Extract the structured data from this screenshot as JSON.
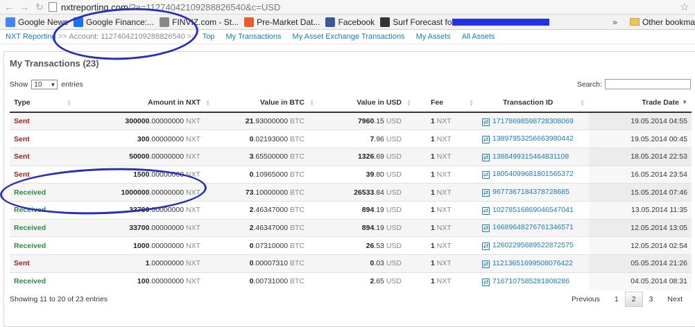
{
  "browser": {
    "url_host": "nxtreporting.com",
    "url_rest": "/?a=11274042109288826540&c=USD",
    "bookmarks": [
      {
        "label": "Google News",
        "icon": "google-news-icon",
        "color": "#4285f4"
      },
      {
        "label": "Google Finance:...",
        "icon": "google-finance-icon",
        "color": "#1a73e8"
      },
      {
        "label": "FINVIZ.com - St...",
        "icon": "finviz-icon",
        "color": "#888888"
      },
      {
        "label": "Pre-Market Dat...",
        "icon": "nbc-peacock-icon",
        "color": "#e85d2a"
      },
      {
        "label": "Facebook",
        "icon": "facebook-icon",
        "color": "#3b5998"
      },
      {
        "label": "Surf Forecast fo...",
        "icon": "surf-forecast-icon",
        "color": "#333333"
      }
    ],
    "more": "»",
    "other_bookmarks": "Other bookma"
  },
  "site_nav": {
    "brand": "NXT Reporting",
    "sep": ">>",
    "account": "Account: 11274042109288826540",
    "sep2": ">>",
    "links": [
      "Top",
      "My Transactions",
      "My Asset Exchange Transactions",
      "My Assets",
      "All Assets"
    ]
  },
  "panel": {
    "title": "My Transactions (23)",
    "show_label": "Show",
    "show_value": "10",
    "entries_label": "entries",
    "search_label": "Search:"
  },
  "table": {
    "columns": [
      "Type",
      "Amount in NXT",
      "Value in BTC",
      "Value in USD",
      "Fee",
      "Transaction ID",
      "Trade Date"
    ],
    "rows": [
      {
        "type": "Sent",
        "amount_int": "300000",
        "amount_dec": ".00000000",
        "amount_unit": "NXT",
        "btc_int": "21",
        "btc_dec": ".93000000",
        "btc_unit": "BTC",
        "usd_int": "7960",
        "usd_dec": ".15",
        "usd_unit": "USD",
        "fee_int": "1",
        "fee_unit": "NXT",
        "tx_id": "17178698598728308069",
        "date": "19.05.2014 04:55"
      },
      {
        "type": "Sent",
        "amount_int": "300",
        "amount_dec": ".00000000",
        "amount_unit": "NXT",
        "btc_int": "0",
        "btc_dec": ".02193000",
        "btc_unit": "BTC",
        "usd_int": "7",
        "usd_dec": ".96",
        "usd_unit": "USD",
        "fee_int": "1",
        "fee_unit": "NXT",
        "tx_id": "13897953256663980442",
        "date": "19.05.2014 00:45"
      },
      {
        "type": "Sent",
        "amount_int": "50000",
        "amount_dec": ".00000000",
        "amount_unit": "NXT",
        "btc_int": "3",
        "btc_dec": ".65500000",
        "btc_unit": "BTC",
        "usd_int": "1326",
        "usd_dec": ".69",
        "usd_unit": "USD",
        "fee_int": "1",
        "fee_unit": "NXT",
        "tx_id": "1388499315464831108",
        "date": "18.05.2014 22:53"
      },
      {
        "type": "Sent",
        "amount_int": "1500",
        "amount_dec": ".00000000",
        "amount_unit": "NXT",
        "btc_int": "0",
        "btc_dec": ".10965000",
        "btc_unit": "BTC",
        "usd_int": "39",
        "usd_dec": ".80",
        "usd_unit": "USD",
        "fee_int": "1",
        "fee_unit": "NXT",
        "tx_id": "18054099681801565372",
        "date": "16.05.2014 23:54"
      },
      {
        "type": "Received",
        "amount_int": "1000000",
        "amount_dec": ".00000000",
        "amount_unit": "NXT",
        "btc_int": "73",
        "btc_dec": ".10000000",
        "btc_unit": "BTC",
        "usd_int": "26533",
        "usd_dec": ".84",
        "usd_unit": "USD",
        "fee_int": "1",
        "fee_unit": "NXT",
        "tx_id": "9677367184378728685",
        "date": "15.05.2014 07:46"
      },
      {
        "type": "Received",
        "amount_int": "33700",
        "amount_dec": ".00000000",
        "amount_unit": "NXT",
        "btc_int": "2",
        "btc_dec": ".46347000",
        "btc_unit": "BTC",
        "usd_int": "894",
        "usd_dec": ".19",
        "usd_unit": "USD",
        "fee_int": "1",
        "fee_unit": "NXT",
        "tx_id": "10278516869046547041",
        "date": "13.05.2014 11:35"
      },
      {
        "type": "Received",
        "amount_int": "33700",
        "amount_dec": ".00000000",
        "amount_unit": "NXT",
        "btc_int": "2",
        "btc_dec": ".46347000",
        "btc_unit": "BTC",
        "usd_int": "894",
        "usd_dec": ".19",
        "usd_unit": "USD",
        "fee_int": "1",
        "fee_unit": "NXT",
        "tx_id": "16689648276761346571",
        "date": "12.05.2014 13:05"
      },
      {
        "type": "Received",
        "amount_int": "1000",
        "amount_dec": ".00000000",
        "amount_unit": "NXT",
        "btc_int": "0",
        "btc_dec": ".07310000",
        "btc_unit": "BTC",
        "usd_int": "26",
        "usd_dec": ".53",
        "usd_unit": "USD",
        "fee_int": "1",
        "fee_unit": "NXT",
        "tx_id": "12602295689522872575",
        "date": "12.05.2014 02:54"
      },
      {
        "type": "Sent",
        "amount_int": "1",
        "amount_dec": ".00000000",
        "amount_unit": "NXT",
        "btc_int": "0",
        "btc_dec": ".00007310",
        "btc_unit": "BTC",
        "usd_int": "0",
        "usd_dec": ".03",
        "usd_unit": "USD",
        "fee_int": "1",
        "fee_unit": "NXT",
        "tx_id": "11213651699508076422",
        "date": "05.05.2014 21:26"
      },
      {
        "type": "Received",
        "amount_int": "100",
        "amount_dec": ".00000000",
        "amount_unit": "NXT",
        "btc_int": "0",
        "btc_dec": ".00731000",
        "btc_unit": "BTC",
        "usd_int": "2",
        "usd_dec": ".65",
        "usd_unit": "USD",
        "fee_int": "1",
        "fee_unit": "NXT",
        "tx_id": "7167107585281808286",
        "date": "04.05.2014 08:31"
      }
    ]
  },
  "footer": {
    "info": "Showing 11 to 20 of 23 entries",
    "previous": "Previous",
    "pages": [
      "1",
      "2",
      "3"
    ],
    "current_page": "2",
    "next": "Next"
  },
  "colors": {
    "sent": "#a21f1f",
    "received": "#2b8a3e",
    "link": "#1a7ab8",
    "annotation": "#2a2fb8"
  }
}
